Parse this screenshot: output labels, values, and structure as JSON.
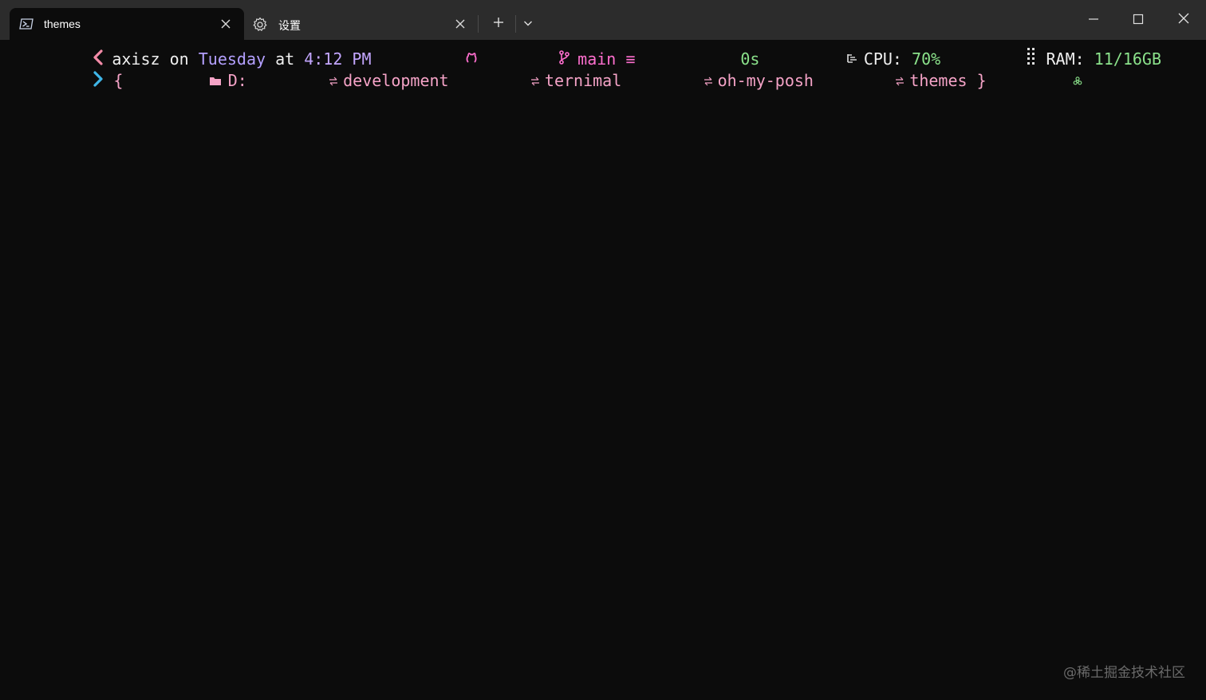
{
  "tabs": [
    {
      "label": "themes",
      "icon": "powershell-icon",
      "active": true
    },
    {
      "label": "设置",
      "icon": "gear-icon",
      "active": false
    }
  ],
  "toolbar": {
    "new_tab_icon": "plus-icon",
    "dropdown_icon": "chevron-down-icon"
  },
  "window_controls": [
    "minimize-icon",
    "maximize-icon",
    "close-icon"
  ],
  "prompt": {
    "line1": {
      "arrow_icon": "chevron-left-icon",
      "user": "axisz",
      "on": "on",
      "day": "Tuesday",
      "at": "at",
      "time": "4:12 PM",
      "git_icon": "github-icon",
      "branch_icon": "git-branch-icon",
      "branch": "main",
      "status": "≡"
    },
    "right": {
      "duration": "0s",
      "cpu_icon": "cpu-icon",
      "cpu_label": "CPU:",
      "cpu_value": "70%",
      "ram_icon": "ram-icon",
      "ram_label": "RAM:",
      "ram_value": "11/16GB"
    },
    "line2": {
      "arrow_icon": "chevron-right-icon",
      "open_brace": "{",
      "folder_icon": "folder-icon",
      "drive": "D:",
      "segments": [
        "development",
        "ternimal",
        "oh-my-posh",
        "themes"
      ],
      "close_brace": "}",
      "status_icon": "biohazard-icon"
    }
  },
  "watermark": "@稀土掘金技术社区",
  "colors": {
    "background": "#0c0c0c",
    "titlebar": "#2c2c2c",
    "pink": "#f38ba8",
    "purple": "#b4a0ff",
    "cyan": "#3fb6e8",
    "green": "#8be28b"
  }
}
